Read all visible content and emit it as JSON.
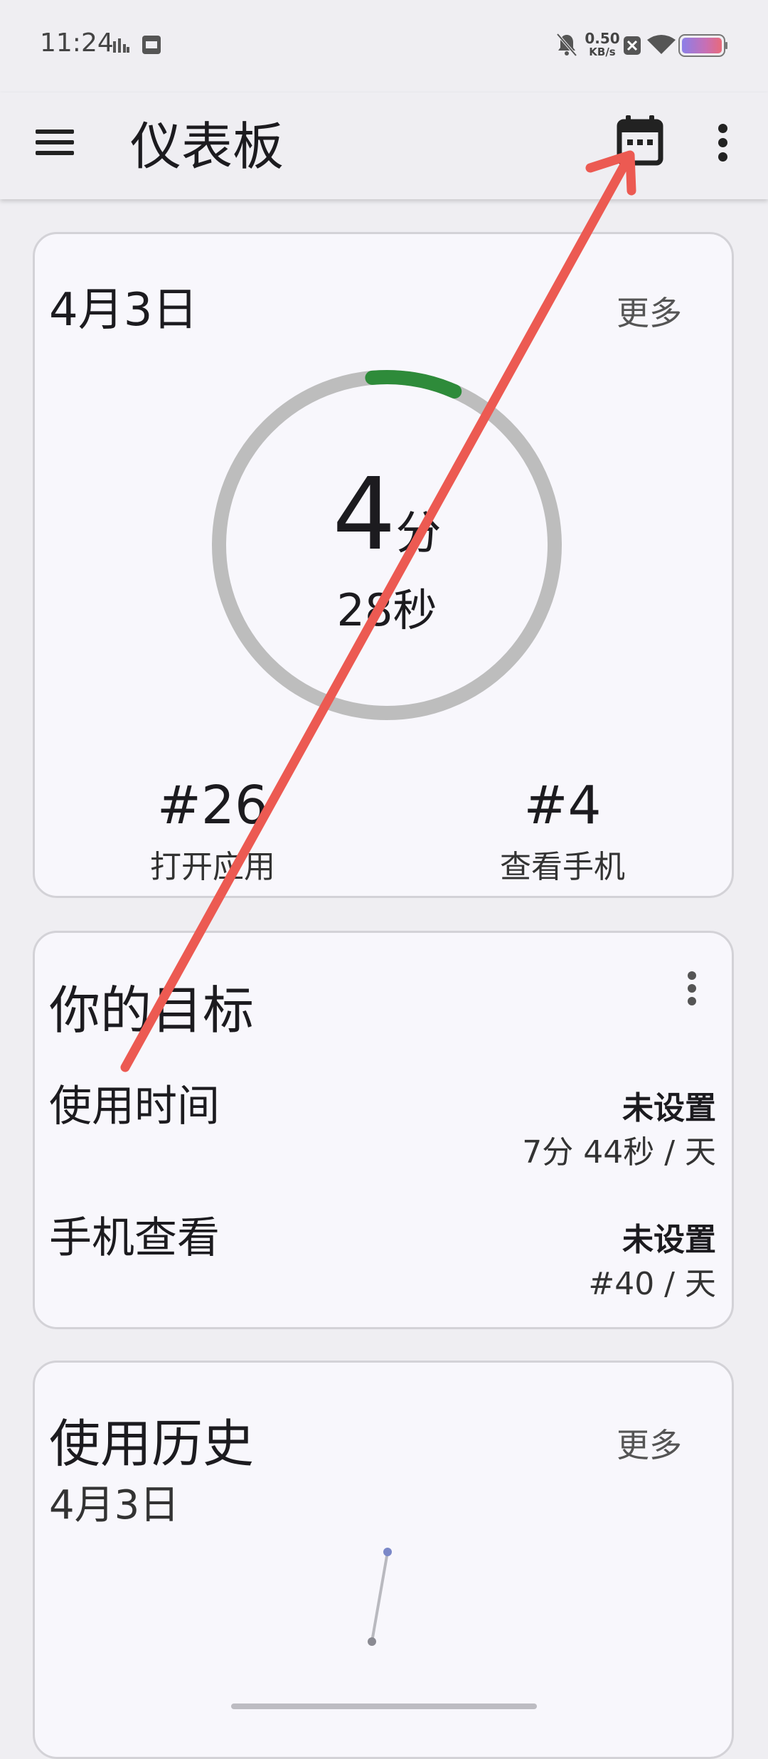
{
  "status_bar": {
    "time": "11:24",
    "net_speed_value": "0.50",
    "net_speed_unit": "KB/s",
    "icons": [
      "signal-bars-icon",
      "sim-icon",
      "mute-bell-icon",
      "data-x-icon",
      "wifi-icon",
      "battery-icon"
    ]
  },
  "app_bar": {
    "title": "仪表板",
    "icons": [
      "menu-icon",
      "calendar-icon",
      "more-vert-icon"
    ]
  },
  "today_card": {
    "date": "4月3日",
    "more_label": "更多",
    "minutes_value": "4",
    "minutes_unit": "分",
    "seconds_text": "28秒",
    "progress_fraction": 0.08,
    "progress_color": "#2e8b3a",
    "track_color": "#bdbdbd",
    "apps_opened_value": "#26",
    "apps_opened_label": "打开应用",
    "unlocks_value": "#4",
    "unlocks_label": "查看手机"
  },
  "goals_card": {
    "title": "你的目标",
    "rows": [
      {
        "name": "使用时间",
        "status": "未设置",
        "detail": "7分 44秒 / 天"
      },
      {
        "name": "手机查看",
        "status": "未设置",
        "detail": "#40 / 天"
      }
    ]
  },
  "history_card": {
    "title": "使用历史",
    "more_label": "更多",
    "date": "4月3日"
  },
  "annotation": {
    "color": "#ec5a52"
  }
}
